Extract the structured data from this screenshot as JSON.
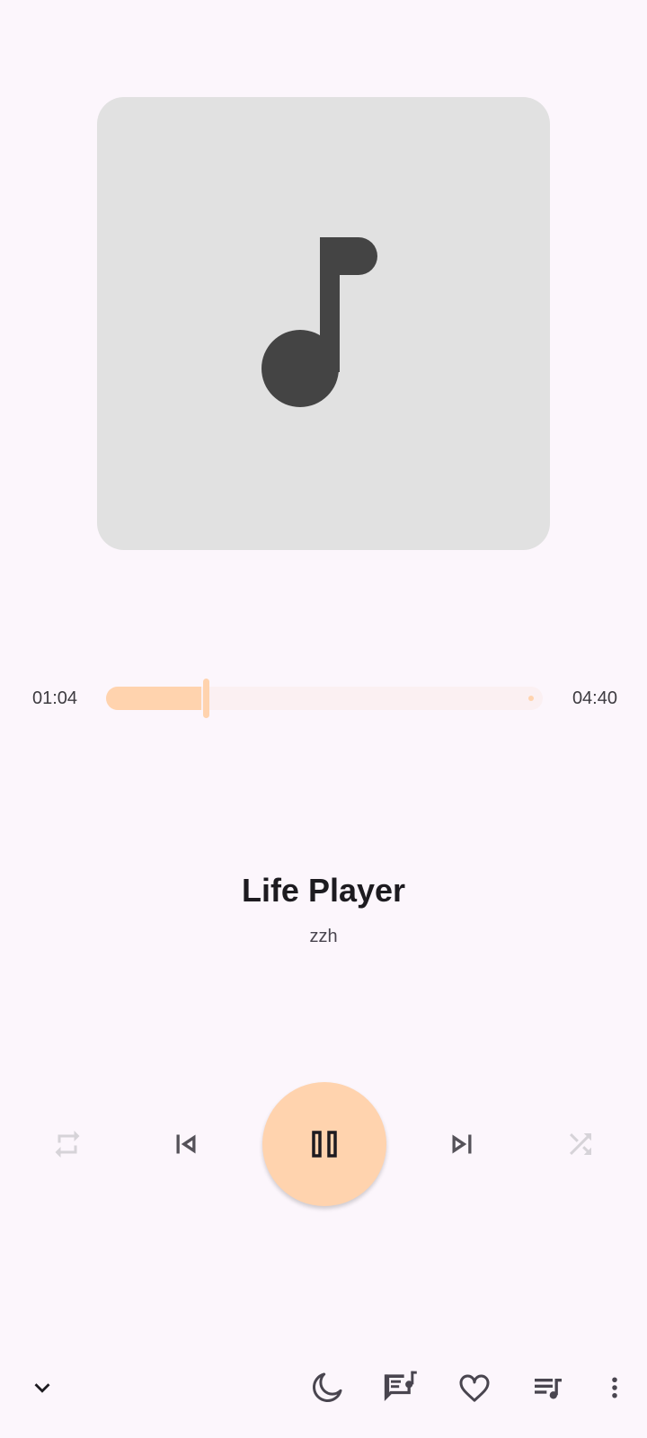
{
  "player": {
    "title": "Life Player",
    "artist": "zzh",
    "elapsed": "01:04",
    "duration": "04:40",
    "progress_fraction": 0.229,
    "accent_color": "#FFD3AE"
  },
  "icons": {
    "album_art": "music-note-icon",
    "repeat": "repeat-icon",
    "previous": "skip-previous-icon",
    "play_pause": "pause-icon",
    "next": "skip-next-icon",
    "shuffle": "shuffle-icon",
    "collapse": "chevron-down-icon",
    "sleep_timer": "moon-icon",
    "lyrics": "lyrics-icon",
    "favorite": "heart-icon",
    "queue": "queue-music-icon",
    "more": "more-vert-icon"
  }
}
